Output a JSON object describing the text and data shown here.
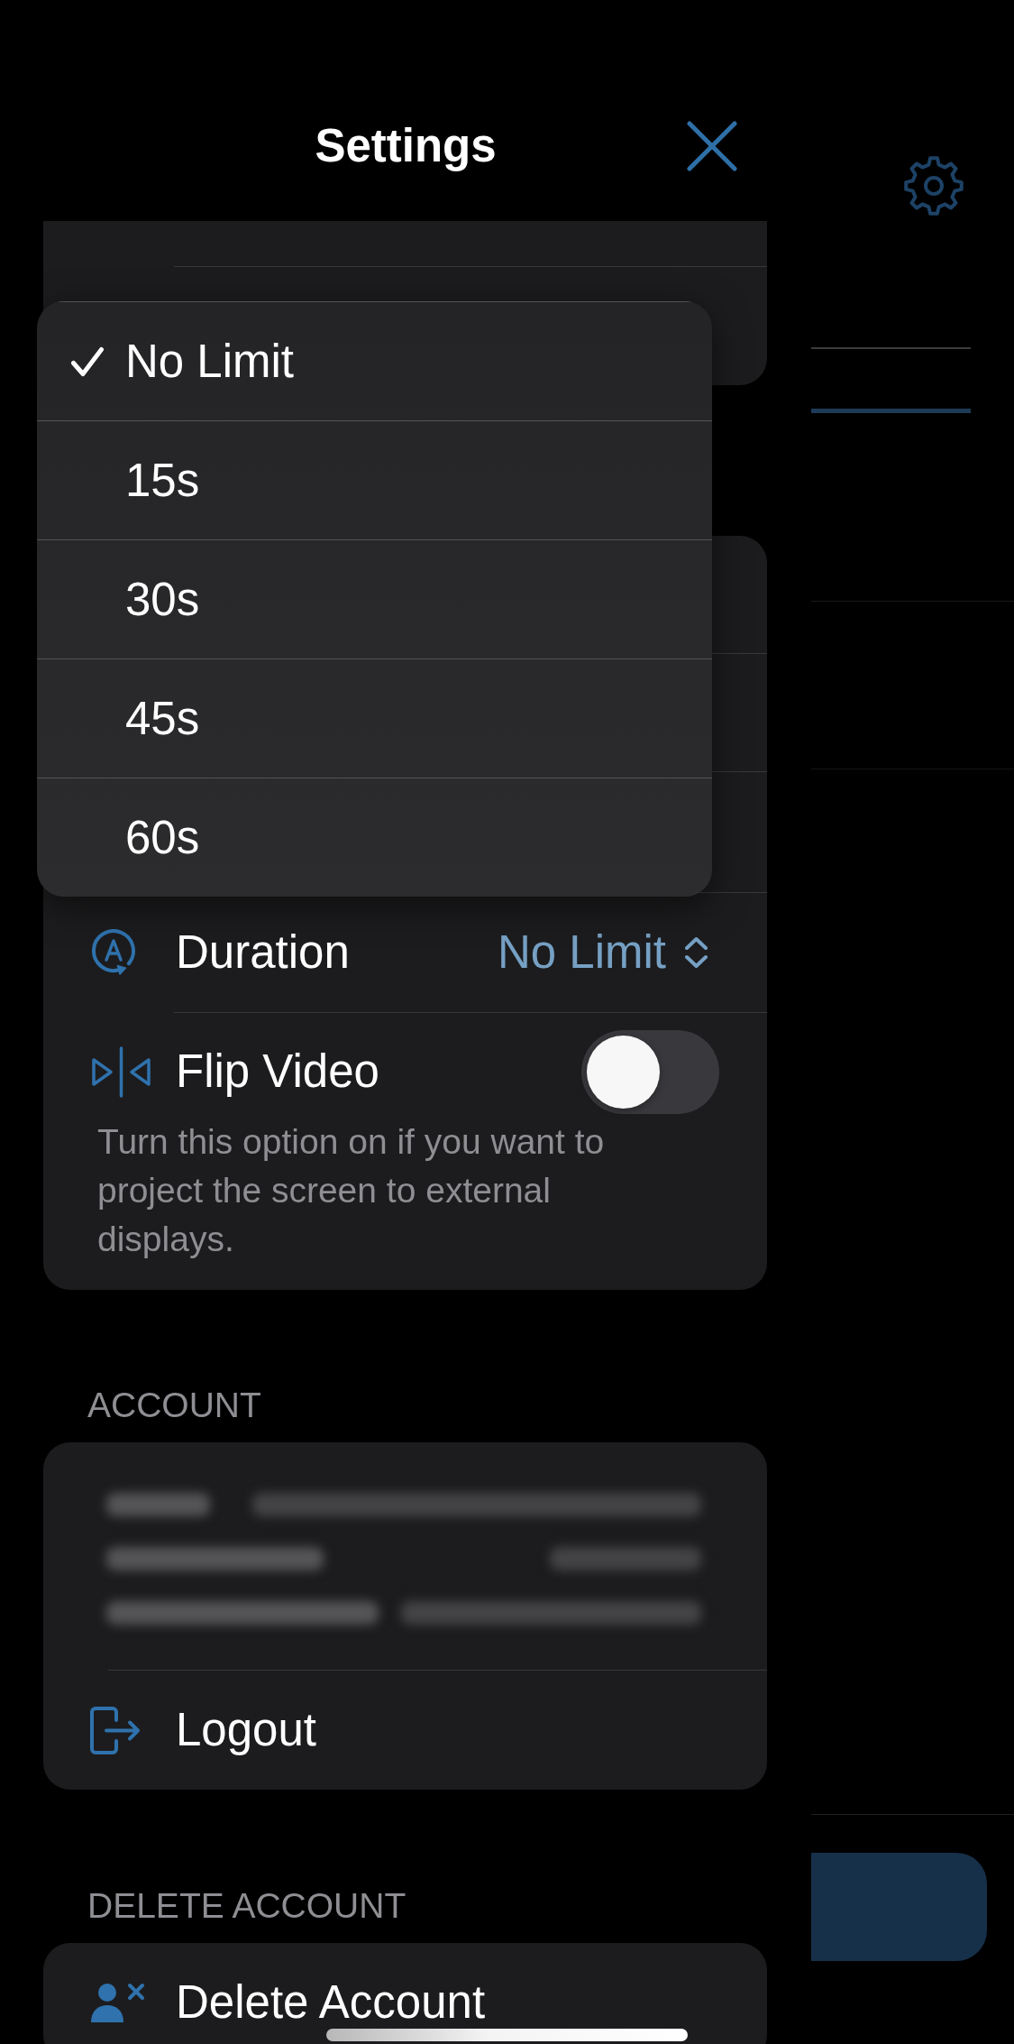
{
  "header": {
    "title": "Settings"
  },
  "duration_menu": {
    "options": [
      {
        "label": "No Limit",
        "selected": true
      },
      {
        "label": "15s",
        "selected": false
      },
      {
        "label": "30s",
        "selected": false
      },
      {
        "label": "45s",
        "selected": false
      },
      {
        "label": "60s",
        "selected": false
      }
    ]
  },
  "video_card": {
    "rows": [
      {
        "kind": "picker",
        "label": "Duration",
        "value": "No Limit"
      },
      {
        "kind": "toggle",
        "label": "Flip Video",
        "on": false,
        "description": "Turn this option on if you want to project the screen to external displays."
      }
    ]
  },
  "account": {
    "section_title": "ACCOUNT",
    "rows": [
      {
        "label": "Logout"
      }
    ]
  },
  "delete_account": {
    "section_title": "DELETE ACCOUNT",
    "rows": [
      {
        "label": "Delete Account"
      }
    ]
  }
}
